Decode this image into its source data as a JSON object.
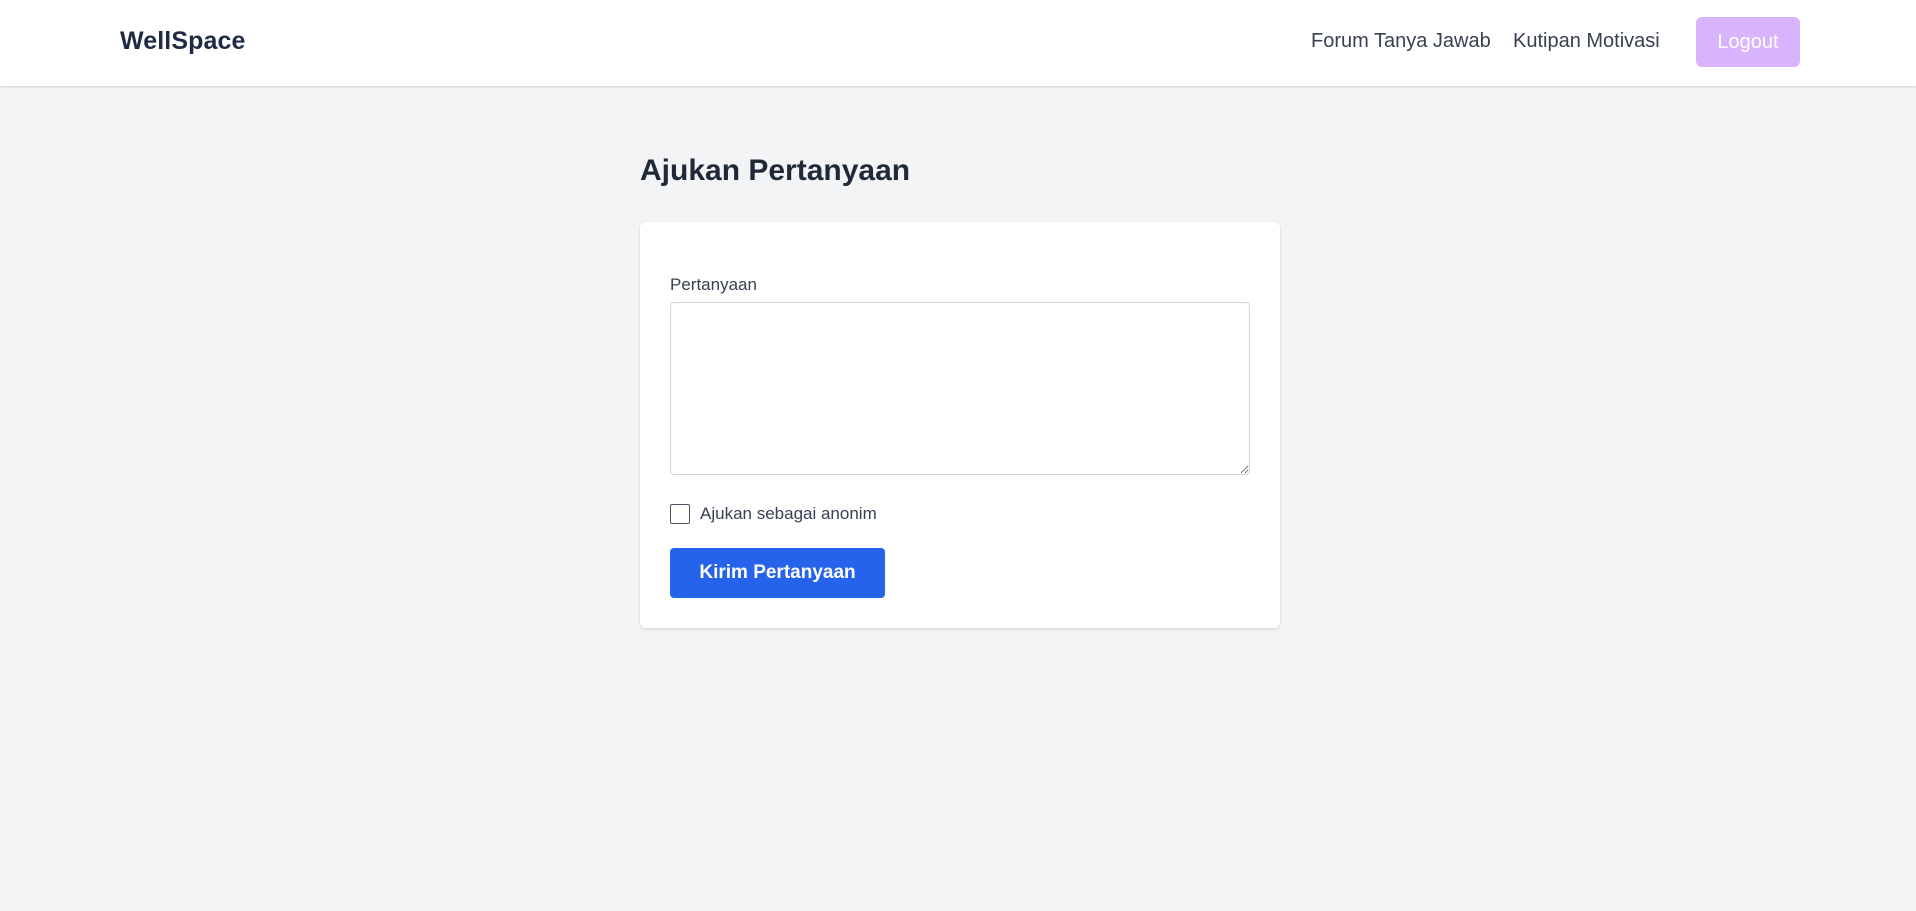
{
  "navbar": {
    "brand": "WellSpace",
    "links": [
      {
        "label": "Forum Tanya Jawab"
      },
      {
        "label": "Kutipan Motivasi"
      }
    ],
    "logout_label": "Logout",
    "logout_color": "#d8b4fe"
  },
  "main": {
    "title": "Ajukan Pertanyaan",
    "form": {
      "question_label": "Pertanyaan",
      "question_value": "",
      "question_placeholder": "",
      "anonymous_label": "Ajukan sebagai anonim",
      "anonymous_checked": false,
      "submit_label": "Kirim Pertanyaan",
      "submit_color": "#2563eb"
    }
  }
}
